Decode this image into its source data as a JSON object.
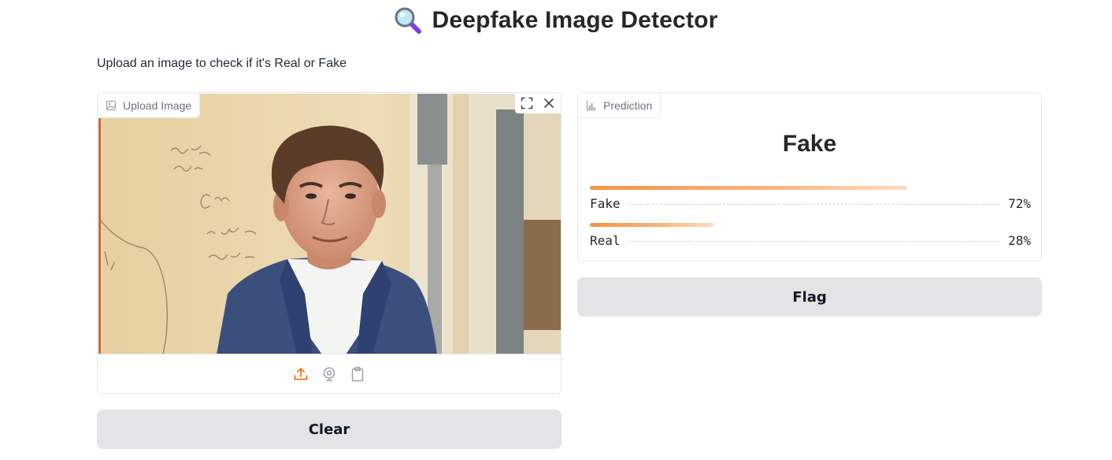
{
  "header": {
    "title": "Deepfake Image Detector",
    "icon": "magnifying-glass-icon",
    "description": "Upload an image to check if it's Real or Fake"
  },
  "upload": {
    "label": "Upload Image",
    "image_alt": "Uploaded photo: man in blue suit and white shirt in front of whiteboard",
    "tools": [
      "fullscreen-icon",
      "close-icon"
    ],
    "sources": [
      "upload-icon",
      "webcam-icon",
      "clipboard-icon"
    ],
    "active_source_color": "#f97316"
  },
  "prediction": {
    "label": "Prediction",
    "result": "Fake",
    "confidences": [
      {
        "label": "Fake",
        "value": 0.72,
        "display": "72%"
      },
      {
        "label": "Real",
        "value": 0.28,
        "display": "28%"
      }
    ]
  },
  "buttons": {
    "flag": "Flag",
    "clear": "Clear"
  },
  "colors": {
    "accent": "#f97316",
    "button_bg": "#e4e4e7",
    "border": "#e5e7eb"
  }
}
